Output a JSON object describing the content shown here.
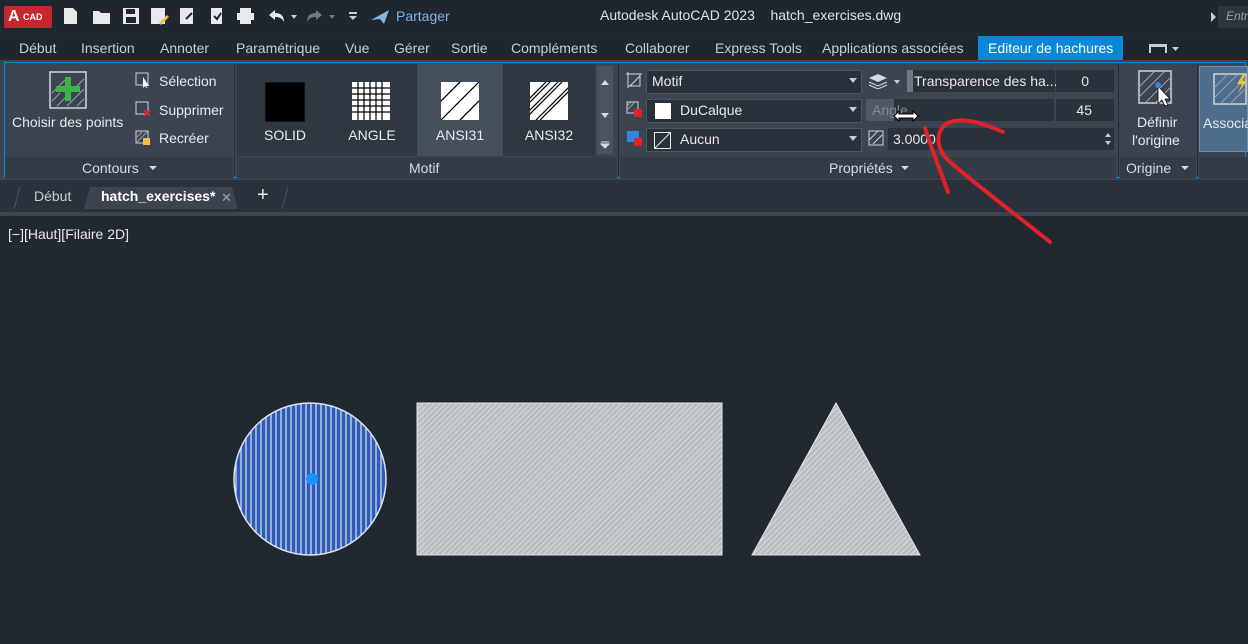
{
  "titlebar": {
    "logo_main": "A",
    "logo_sub": "CAD",
    "share_label": "Partager",
    "app_title": "Autodesk AutoCAD 2023    hatch_exercises.dwg",
    "search_placeholder": "Entr"
  },
  "ribbon_tabs": [
    {
      "label": "Début"
    },
    {
      "label": "Insertion"
    },
    {
      "label": "Annoter"
    },
    {
      "label": "Paramétrique"
    },
    {
      "label": "Vue"
    },
    {
      "label": "Gérer"
    },
    {
      "label": "Sortie"
    },
    {
      "label": "Compléments"
    },
    {
      "label": "Collaborer"
    },
    {
      "label": "Express Tools"
    },
    {
      "label": "Applications associées"
    },
    {
      "label": "Editeur de hachures"
    }
  ],
  "contours": {
    "pick_points": "Choisir des points",
    "selection": "Sélection",
    "delete": "Supprimer",
    "recreate": "Recréer",
    "panel_title": "Contours"
  },
  "motif": {
    "swatches": [
      {
        "label": "SOLID"
      },
      {
        "label": "ANGLE"
      },
      {
        "label": "ANSI31"
      },
      {
        "label": "ANSI32"
      }
    ],
    "panel_title": "Motif"
  },
  "properties": {
    "type_value": "Motif",
    "color_value": "DuCalque",
    "background_value": "Aucun",
    "transparency_label": "Transparence des ha...",
    "transparency_value": "0",
    "angle_label": "Angle",
    "angle_value": "45",
    "scale_value": "3.0000",
    "panel_title": "Propriétés"
  },
  "origin": {
    "set_origin_line1": "Définir",
    "set_origin_line2": "l'origine",
    "panel_title": "Origine",
    "associative_label": "Associa"
  },
  "doc_tabs": {
    "start": "Début",
    "active": "hatch_exercises*",
    "close": "✕",
    "add": "+"
  },
  "viewport": {
    "label": "[−][Haut][Filaire 2D]"
  },
  "colors": {
    "active_tab": "#0a87d6",
    "selection_blue": "#2f5bb5",
    "annotation_red": "#e0232b"
  }
}
